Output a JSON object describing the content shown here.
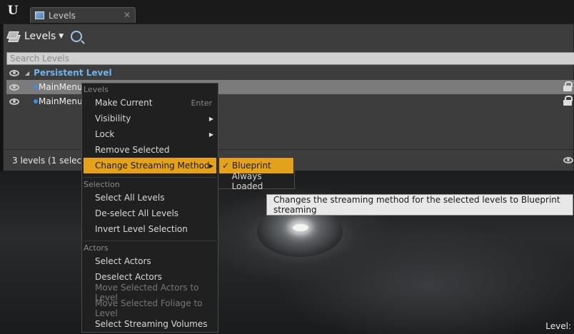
{
  "app": {
    "logo": "U"
  },
  "tab": {
    "label": "Levels",
    "close": "✕"
  },
  "toolbar": {
    "levels_menu_label": "Levels",
    "caret": "▼"
  },
  "search": {
    "placeholder": "Search Levels",
    "value": ""
  },
  "tree": {
    "persistent": {
      "label": "Persistent Level",
      "expand": "◢"
    },
    "levels": [
      {
        "name": "MainMenu"
      },
      {
        "name": "MainMenu"
      }
    ]
  },
  "status": {
    "text": "3 levels (1 selected)"
  },
  "viewport": {
    "level_label": "Level:"
  },
  "context_menu": {
    "sections": [
      {
        "header": "Levels",
        "items": [
          {
            "label": "Make Current",
            "shortcut": "Enter"
          },
          {
            "label": "Visibility",
            "submenu": true
          },
          {
            "label": "Lock",
            "submenu": true
          },
          {
            "label": "Remove Selected"
          },
          {
            "label": "Change Streaming Method",
            "submenu": true,
            "active": true
          }
        ]
      },
      {
        "header": "Selection",
        "items": [
          {
            "label": "Select All Levels"
          },
          {
            "label": "De-select All Levels"
          },
          {
            "label": "Invert Level Selection"
          }
        ]
      },
      {
        "header": "Actors",
        "items": [
          {
            "label": "Select Actors"
          },
          {
            "label": "Deselect Actors"
          },
          {
            "label": "Move Selected Actors to Level",
            "disabled": true
          },
          {
            "label": "Move Selected Foliage to Level",
            "disabled": true
          },
          {
            "label": "Select Streaming Volumes"
          }
        ]
      }
    ],
    "arrow_glyph": "▶"
  },
  "submenu": {
    "items": [
      {
        "label": "Blueprint",
        "checked": true,
        "check": "✓"
      },
      {
        "label": "Always Loaded",
        "checked": false
      }
    ]
  },
  "tooltip": {
    "text": "Changes the streaming method for the selected levels to Blueprint streaming"
  },
  "colors": {
    "accent": "#e4a11b",
    "persistent_level": "#73b4ee",
    "level_dot": "#3a8ee6"
  },
  "icons": [
    "unreal-logo-icon",
    "levels-tab-icon",
    "close-icon",
    "levels-icon",
    "magnify-icon",
    "eye-icon",
    "expand-triangle-icon",
    "lock-icon",
    "submenu-arrow-icon",
    "checkmark-icon"
  ]
}
